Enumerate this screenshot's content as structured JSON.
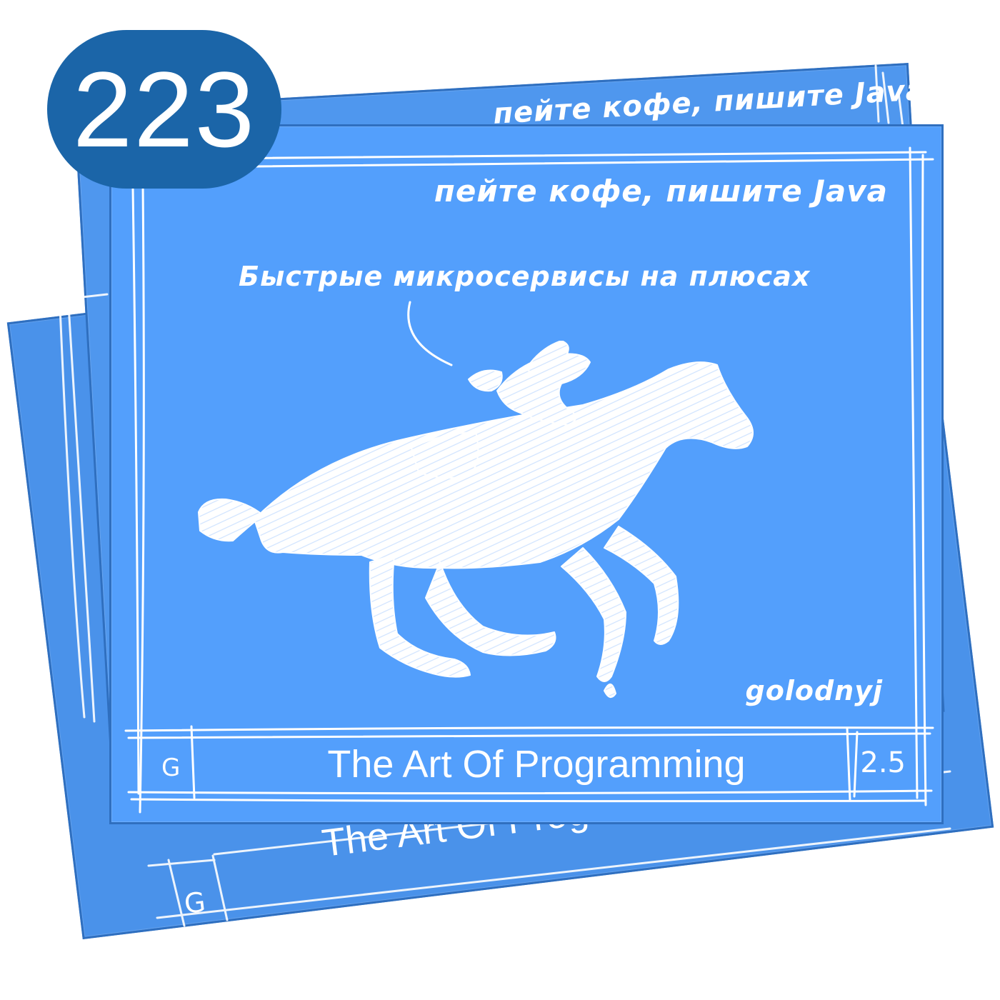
{
  "badge": {
    "number": "223"
  },
  "card": {
    "tagline": "пейте кофе, пишите Java",
    "speech": "Быстрые микросервисы на плюсах",
    "author": "golodnyj",
    "footer": {
      "title": "The Art Of Programming",
      "left_mark": "G",
      "right_mark": "2.5"
    }
  },
  "back_cards": {
    "top_tagline": "пейте кофе, пишите Java",
    "bottom_title": "The Art Of Program",
    "bottom_left_mark": "G"
  },
  "colors": {
    "card_front": "#539ffc",
    "card_back": "#4f97ee",
    "card_border": "#2f6fbf",
    "badge": "#1b65a8",
    "chalk": "#ffffff"
  },
  "icons": {
    "illustration": "racehorse-with-jockey-icon",
    "speech_pointer": "speech-tail-icon"
  }
}
